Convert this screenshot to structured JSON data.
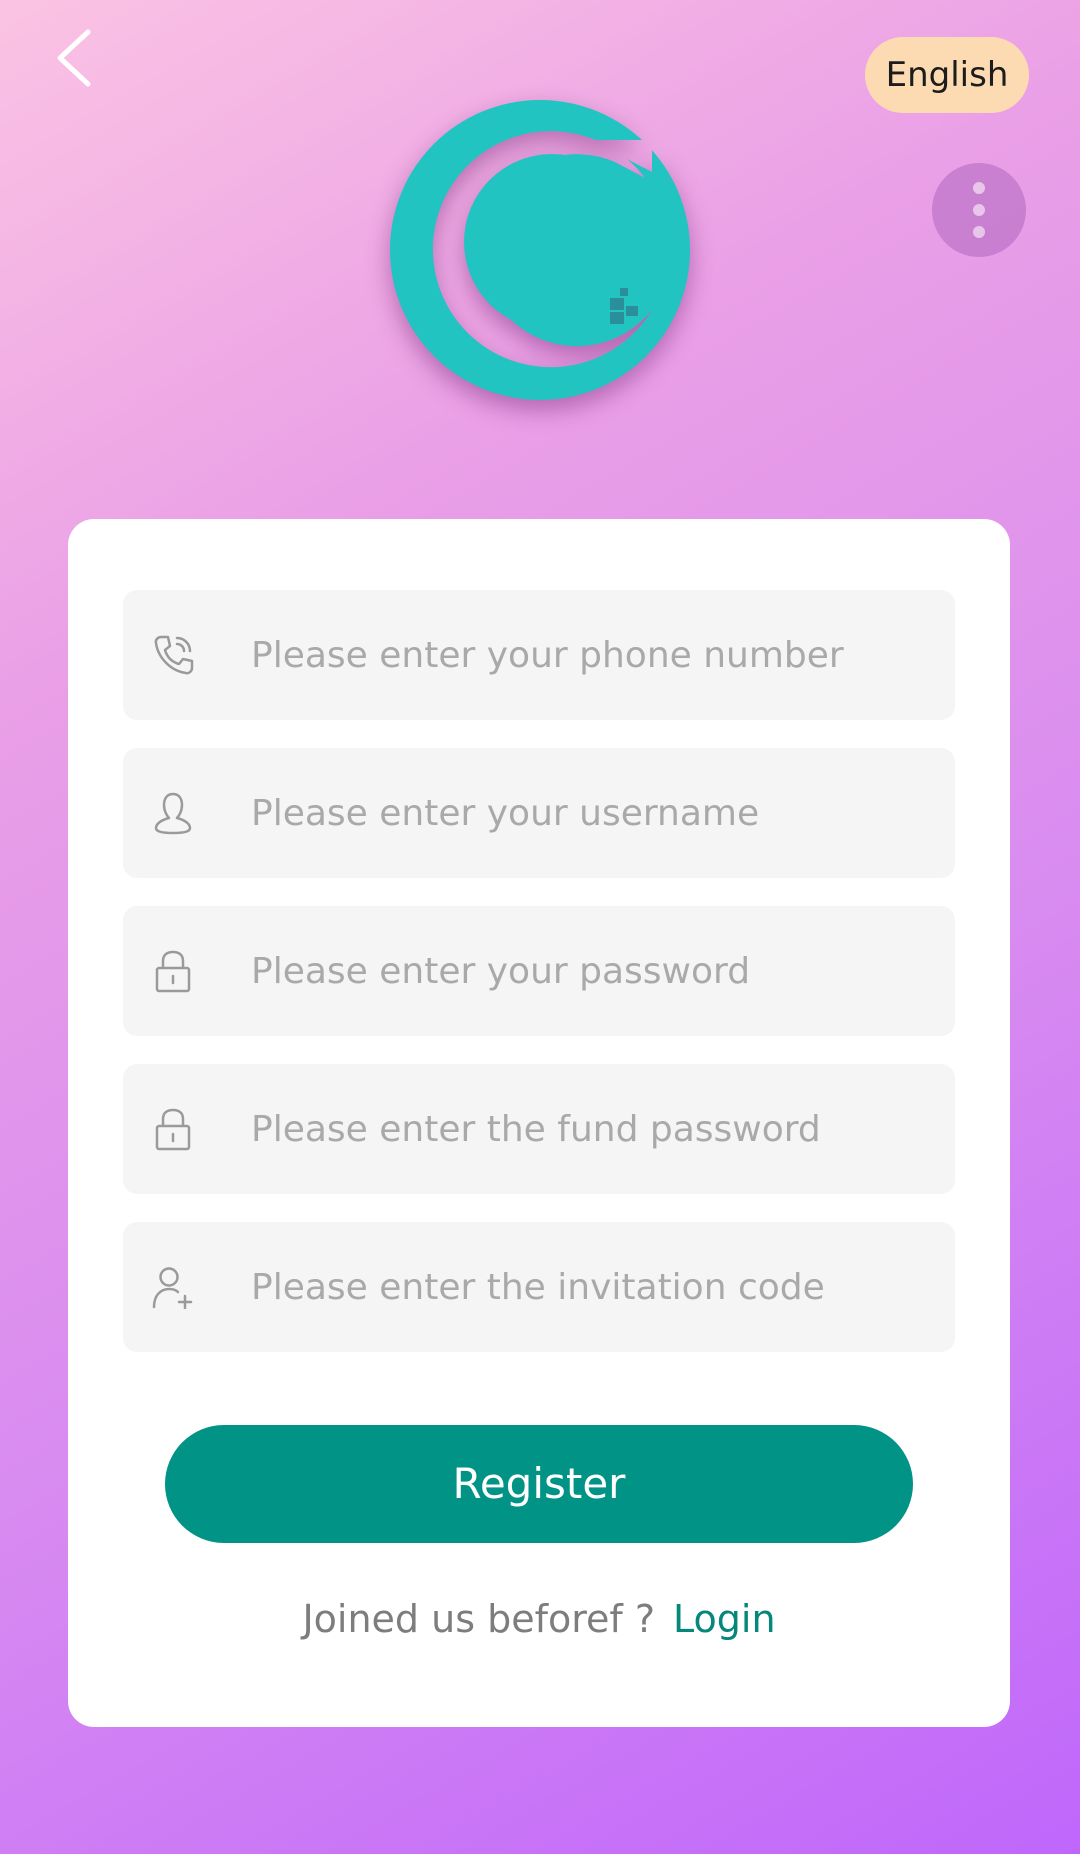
{
  "header": {
    "language_label": "English"
  },
  "form": {
    "fields": [
      {
        "icon": "phone-icon",
        "placeholder": "Please enter your phone number"
      },
      {
        "icon": "user-icon",
        "placeholder": "Please enter your username"
      },
      {
        "icon": "lock-icon",
        "placeholder": "Please enter your password"
      },
      {
        "icon": "lock-icon",
        "placeholder": "Please enter the fund password"
      },
      {
        "icon": "user-add-icon",
        "placeholder": "Please enter the invitation code"
      }
    ],
    "register_label": "Register",
    "login_prompt": "Joined us beforef ?",
    "login_label": "Login"
  },
  "colors": {
    "accent": "#019386",
    "logo": "#22c4c2",
    "language_button": "#fddbb2",
    "link": "#05877c"
  }
}
